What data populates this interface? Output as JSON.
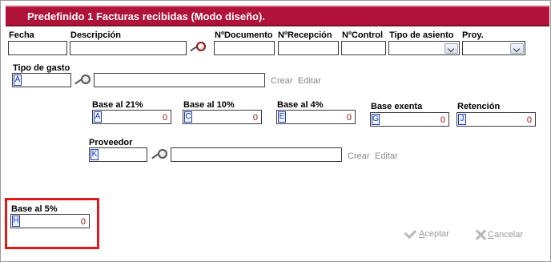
{
  "window": {
    "title": "Predefinido 1 Facturas recibidas (Modo diseño)."
  },
  "header_fields": {
    "fecha_label": "Fecha",
    "descripcion_label": "Descripción",
    "num_documento_label": "NºDocumento",
    "num_recepcion_label": "NºRecepción",
    "num_control_label": "NºControl",
    "tipo_asiento_label": "Tipo de asiento",
    "proy_label": "Proy."
  },
  "tipo_gasto": {
    "label": "Tipo de gasto",
    "code_letter": "A",
    "create_link": "Crear",
    "edit_link": "Editar"
  },
  "bases": [
    {
      "label": "Base al  21%",
      "letter": "A",
      "value": "0"
    },
    {
      "label": "Base al 10%",
      "letter": "C",
      "value": "0"
    },
    {
      "label": "Base al 4%",
      "letter": "E",
      "value": "0"
    },
    {
      "label": "Base exenta",
      "letter": "G",
      "value": "0"
    },
    {
      "label": "Retención",
      "letter": "J",
      "value": "0"
    }
  ],
  "proveedor": {
    "label": "Proveedor",
    "code_letter": "K",
    "create_link": "Crear",
    "edit_link": "Editar"
  },
  "base_5": {
    "label": "Base al 5%",
    "letter": "H",
    "value": "0"
  },
  "actions": {
    "accept_first": "A",
    "accept_rest": "ceptar",
    "cancel_first": "C",
    "cancel_rest": "ancelar"
  },
  "colors": {
    "title_bg": "#b0123a",
    "highlight": "#e01a1a",
    "amount_text": "#9a1010",
    "code_letter": "#1a3bb5"
  }
}
